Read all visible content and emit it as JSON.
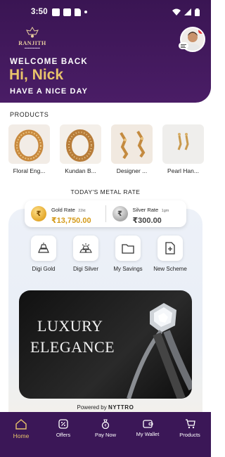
{
  "status_bar": {
    "time": "3:50"
  },
  "header": {
    "brand": "RANJITH",
    "welcome": "WELCOME BACK",
    "greeting": "Hi, Nick",
    "subtitle": "HAVE A NICE DAY"
  },
  "products": {
    "label": "PRODUCTS",
    "items": [
      {
        "name": "Floral Eng..."
      },
      {
        "name": "Kundan B..."
      },
      {
        "name": "Designer ..."
      },
      {
        "name": "Pearl Han..."
      }
    ]
  },
  "metal_rate": {
    "title": "TODAY'S METAL RATE",
    "gold": {
      "label": "Gold Rate",
      "unit": "22kt",
      "value": "₹13,750.00",
      "symbol": "₹"
    },
    "silver": {
      "label": "Silver Rate",
      "unit": "1gm",
      "value": "₹300.00",
      "symbol": "₹"
    }
  },
  "actions": [
    {
      "label": "Digi Gold",
      "icon": "gold-bars-icon"
    },
    {
      "label": "Digi Silver",
      "icon": "silver-bars-icon"
    },
    {
      "label": "My Savings",
      "icon": "folder-icon"
    },
    {
      "label": "New Scheme",
      "icon": "new-document-icon"
    }
  ],
  "banner": {
    "line1": "LUXURY",
    "line2": "ELEGANCE"
  },
  "footer": {
    "powered_by": "Powered by",
    "brand": "NYTTRO"
  },
  "bottom_nav": [
    {
      "label": "Home",
      "icon": "home-icon",
      "active": true
    },
    {
      "label": "Offers",
      "icon": "offers-icon"
    },
    {
      "label": "Pay Now",
      "icon": "pay-icon"
    },
    {
      "label": "My Wallet",
      "icon": "wallet-icon"
    },
    {
      "label": "Products",
      "icon": "cart-icon"
    }
  ],
  "colors": {
    "primary": "#3b1757",
    "accent_gold": "#e8c36b",
    "gold_value": "#d49a1a"
  }
}
